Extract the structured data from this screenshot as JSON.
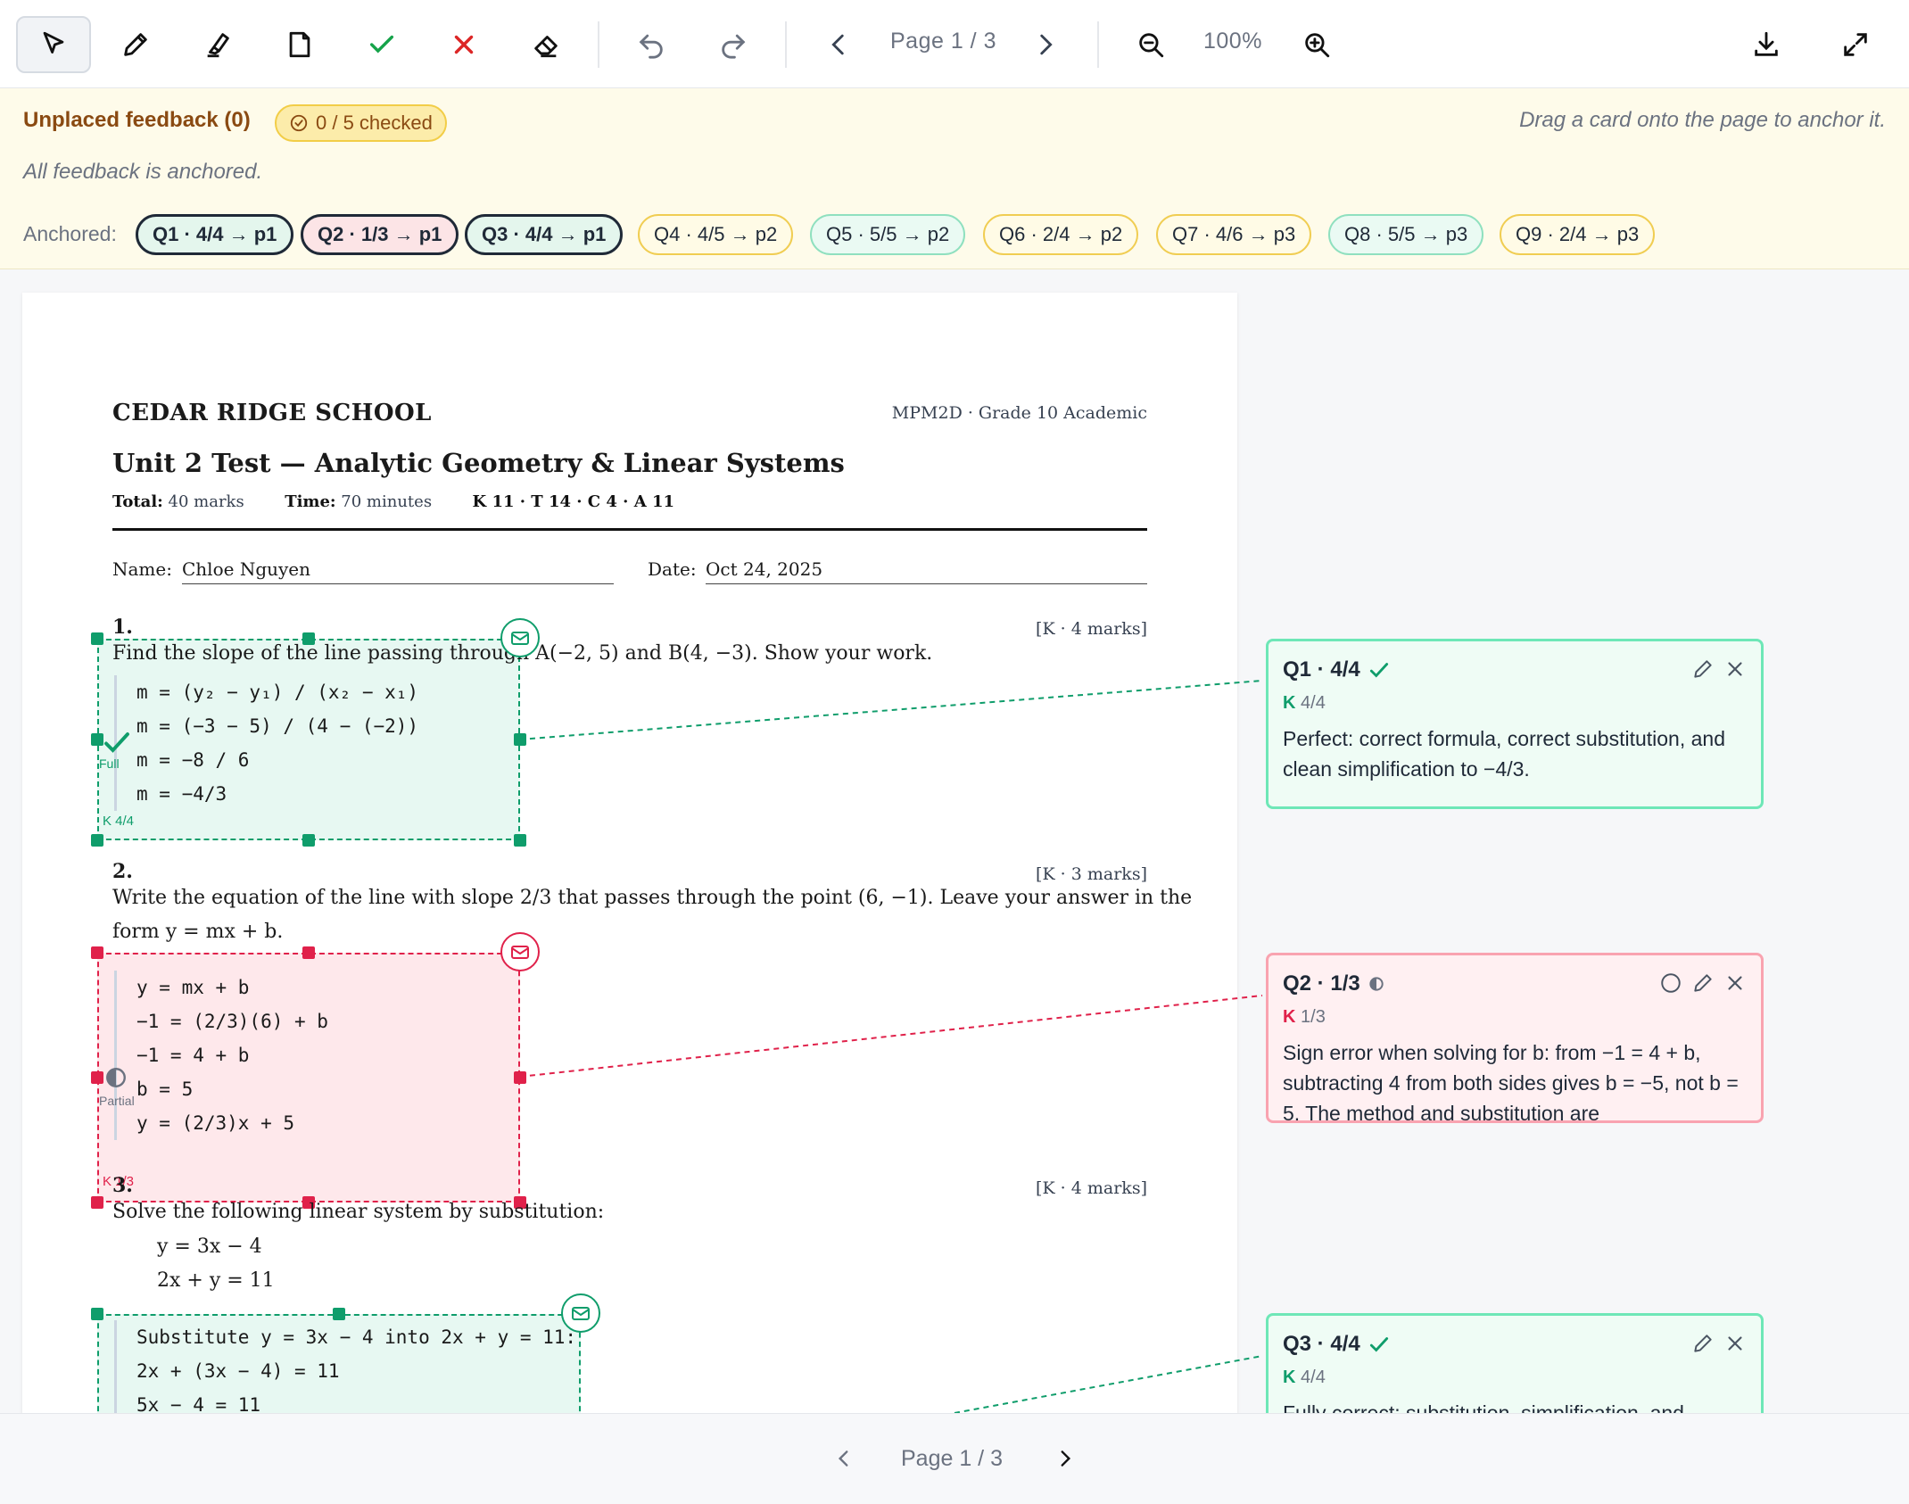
{
  "toolbar": {
    "tools": [
      "select-icon",
      "pen-icon",
      "highlighter-icon",
      "note-icon",
      "check-icon",
      "cross-icon",
      "eraser-icon",
      "undo-icon",
      "redo-icon"
    ],
    "page_label": "Page 1 / 3",
    "zoom": "100%"
  },
  "banner": {
    "title": "Unplaced feedback (0)",
    "checked": "0 / 5 checked",
    "hint": "Drag a card onto the page to anchor it.",
    "status": "All feedback is anchored.",
    "anchored_label": "Anchored:",
    "chips": [
      "Q1 · 4/4 → p1",
      "Q2 · 1/3 → p1",
      "Q3 · 4/4 → p1",
      "Q4 · 4/5 → p2",
      "Q5 · 5/5 → p2",
      "Q6 · 2/4 → p2",
      "Q7 · 4/6 → p3",
      "Q8 · 5/5 → p3",
      "Q9 · 2/4 → p3"
    ]
  },
  "paper": {
    "school": "CEDAR RIDGE SCHOOL",
    "course": "MPM2D · Grade 10 Academic",
    "title": "Unit 2 Test — Analytic Geometry & Linear Systems",
    "total_label": "Total:",
    "total_value": "40 marks",
    "time_label": "Time:",
    "time_value": "70 minutes",
    "categories": "K 11 · T 14 · C 4 · A 11",
    "name_label": "Name:",
    "name_value": "Chloe Nguyen",
    "date_label": "Date:",
    "date_value": "Oct 24, 2025",
    "questions": [
      {
        "num": "1.",
        "marks": "[K · 4 marks]",
        "text": "Find the slope of the line passing through A(−2, 5) and B(4, −3). Show your work.",
        "work": [
          "m = (y₂ − y₁) / (x₂ − x₁)",
          "m = (−3 − 5) / (4 − (−2))",
          "m = −8 / 6",
          "m = −4/3"
        ],
        "status": "Full",
        "score": "K 4/4"
      },
      {
        "num": "2.",
        "marks": "[K · 3 marks]",
        "text_line1": "Write the equation of the line with slope 2/3 that passes through the point (6, −1). Leave your answer in the",
        "text_line2": "form y = mx + b.",
        "work": [
          "y = mx + b",
          "−1 = (2/3)(6) + b",
          "−1 = 4 + b",
          "b = 5",
          "y = (2/3)x + 5"
        ],
        "status": "Partial",
        "score": "K 1/3"
      },
      {
        "num": "3.",
        "marks": "[K · 4 marks]",
        "text": "Solve the following linear system by substitution:",
        "eq1": "y = 3x − 4",
        "eq2": "2x + y = 11",
        "work": [
          "Substitute y = 3x − 4 into 2x + y = 11:",
          "2x + (3x − 4) = 11",
          "5x − 4 = 11"
        ]
      }
    ]
  },
  "cards": [
    {
      "title": "Q1 · 4/4",
      "k_prefix": "K",
      "k_score": "4/4",
      "body": "Perfect: correct formula, correct substitution, and clean simplification to −4/3."
    },
    {
      "title": "Q2 · 1/3",
      "k_prefix": "K",
      "k_score": "1/3",
      "body": "Sign error when solving for b: from −1 = 4 + b, subtracting 4 from both sides gives b = −5, not b = 5. The method and substitution are"
    },
    {
      "title": "Q3 · 4/4",
      "k_prefix": "K",
      "k_score": "4/4",
      "body": "Fully correct: substitution, simplification, and"
    }
  ],
  "footer": {
    "page_label": "Page 1 / 3"
  },
  "colors": {
    "green": "#0f9d6b",
    "red": "#e0214a",
    "banner_bg": "#fefbea"
  }
}
